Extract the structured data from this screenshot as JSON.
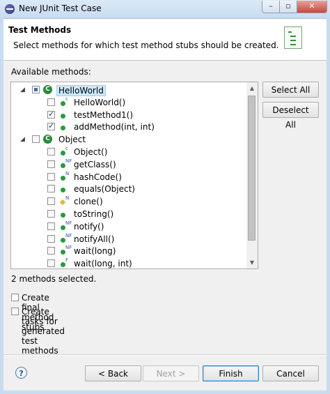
{
  "window": {
    "title": "New JUnit Test Case"
  },
  "header": {
    "title": "Test Methods",
    "description": "Select methods for which test method stubs should be created."
  },
  "available_label": "Available methods:",
  "tree": [
    {
      "label": "HelloWorld",
      "level": 0,
      "expanded": true,
      "check": "partial",
      "icon": "class-icon",
      "selected": true
    },
    {
      "label": "HelloWorld()",
      "level": 1,
      "check": "unchecked",
      "icon": "public-method-icon",
      "badge": "c"
    },
    {
      "label": "testMethod1()",
      "level": 1,
      "check": "checked",
      "icon": "public-method-icon",
      "badge": ""
    },
    {
      "label": "addMethod(int, int)",
      "level": 1,
      "check": "checked",
      "icon": "public-method-icon",
      "badge": ""
    },
    {
      "label": "Object",
      "level": 0,
      "expanded": true,
      "check": "unchecked",
      "icon": "class-icon",
      "selected": false
    },
    {
      "label": "Object()",
      "level": 1,
      "check": "unchecked",
      "icon": "public-method-icon",
      "badge": "c"
    },
    {
      "label": "getClass()",
      "level": 1,
      "check": "unchecked",
      "icon": "public-method-icon",
      "badge": "NF"
    },
    {
      "label": "hashCode()",
      "level": 1,
      "check": "unchecked",
      "icon": "public-method-icon",
      "badge": "N"
    },
    {
      "label": "equals(Object)",
      "level": 1,
      "check": "unchecked",
      "icon": "public-method-icon",
      "badge": ""
    },
    {
      "label": "clone()",
      "level": 1,
      "check": "unchecked",
      "icon": "protected-method-icon",
      "badge": "N"
    },
    {
      "label": "toString()",
      "level": 1,
      "check": "unchecked",
      "icon": "public-method-icon",
      "badge": ""
    },
    {
      "label": "notify()",
      "level": 1,
      "check": "unchecked",
      "icon": "public-method-icon",
      "badge": "NF"
    },
    {
      "label": "notifyAll()",
      "level": 1,
      "check": "unchecked",
      "icon": "public-method-icon",
      "badge": "NF"
    },
    {
      "label": "wait(long)",
      "level": 1,
      "check": "unchecked",
      "icon": "public-method-icon",
      "badge": "NF"
    },
    {
      "label": "wait(long, int)",
      "level": 1,
      "check": "unchecked",
      "icon": "public-method-icon",
      "badge": "F"
    }
  ],
  "side_buttons": {
    "select_all": "Select All",
    "deselect_all": "Deselect All"
  },
  "status": "2 methods selected.",
  "options": {
    "final_stubs": {
      "label": "Create final method stubs",
      "checked": false
    },
    "tasks": {
      "label": "Create tasks for generated test methods",
      "checked": false
    }
  },
  "footer": {
    "help": "?",
    "back": "< Back",
    "next": "Next >",
    "finish": "Finish",
    "cancel": "Cancel"
  }
}
